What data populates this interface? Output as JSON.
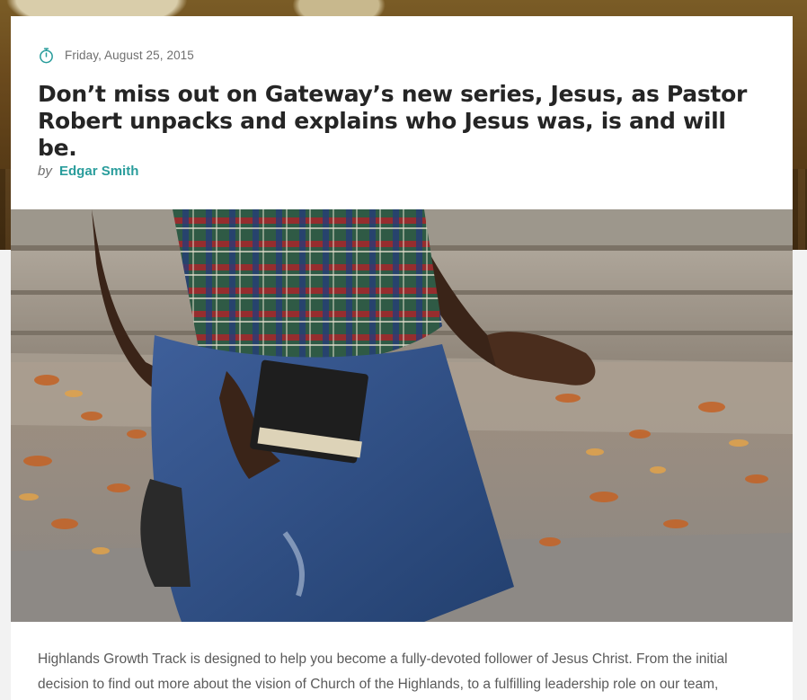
{
  "post": {
    "date": "Friday, August 25, 2015",
    "title": "Don’t miss out on Gateway’s new series, Jesus, as Pastor Robert unpacks and explains who Jesus was, is and will be.",
    "byline_prefix": "by",
    "author": "Edgar Smith",
    "body": "Highlands Growth Track is designed to help you become a fully-devoted follower of Jesus Christ. From the initial decision to find out more about the vision of Church of the Highlands, to a fulfilling leadership role on our team,"
  },
  "icons": {
    "date": "stopwatch-icon"
  },
  "colors": {
    "accent": "#2a9d9c",
    "title": "#252525",
    "body_text": "#5a5a5a",
    "meta_text": "#6f6f6f"
  }
}
